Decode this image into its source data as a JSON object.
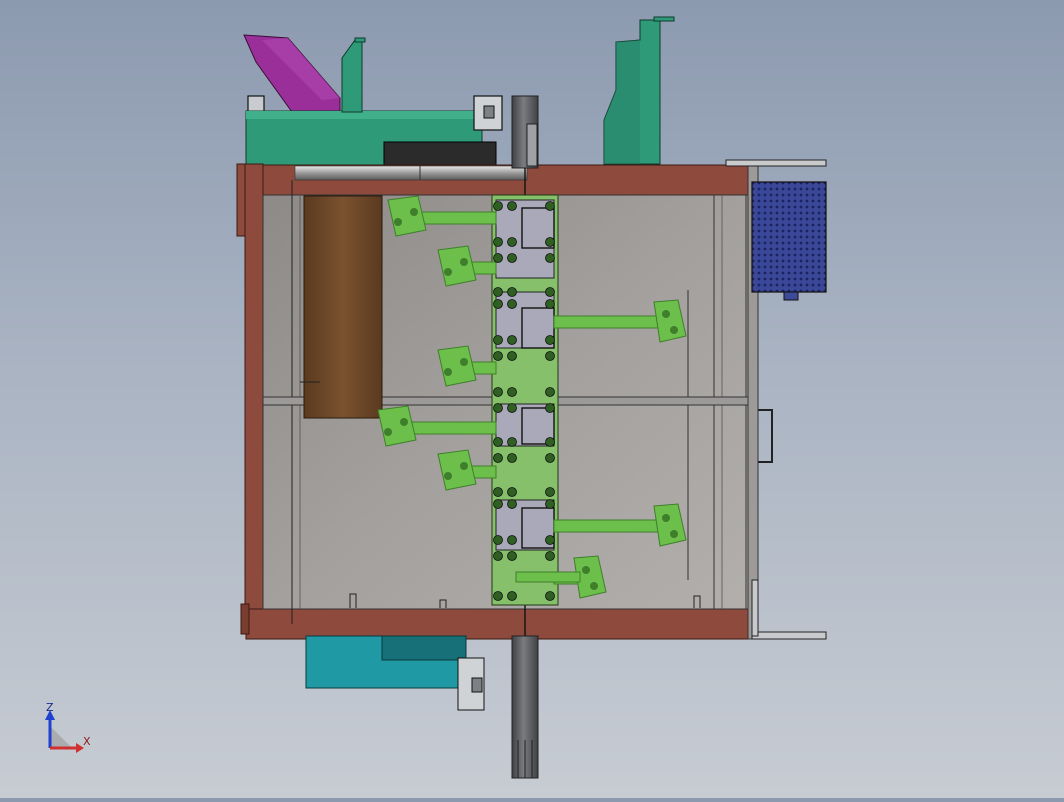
{
  "triad": {
    "z_label": "Z",
    "x_label": "X"
  },
  "colors": {
    "frame": "#8e4a3c",
    "frame_dark": "#6e3428",
    "panel": "#9a9896",
    "arm": "#6cbf4a",
    "arm_dark": "#3f7f2c",
    "shaft": "#5e6064",
    "motor_base": "#2e9a78",
    "chute": "#9a2f9a",
    "teal_block": "#1f9aa4",
    "brown_plate": "#6b4a2b",
    "vent_box": "#3d4a9a",
    "axis_x": "#d03030",
    "axis_z": "#2040d0"
  }
}
